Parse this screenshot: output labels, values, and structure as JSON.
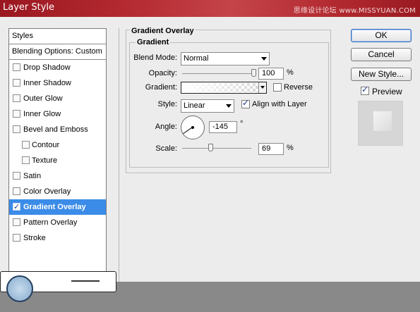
{
  "window": {
    "title": "Layer Style",
    "watermark": "思缘设计论坛 www.MISSYUAN.COM"
  },
  "styles_list": {
    "header": "Styles",
    "blending": "Blending Options: Custom",
    "items": [
      {
        "label": "Drop Shadow",
        "checked": false
      },
      {
        "label": "Inner Shadow",
        "checked": false
      },
      {
        "label": "Outer Glow",
        "checked": false
      },
      {
        "label": "Inner Glow",
        "checked": false
      },
      {
        "label": "Bevel and Emboss",
        "checked": false
      },
      {
        "label": "Contour",
        "checked": false
      },
      {
        "label": "Texture",
        "checked": false
      },
      {
        "label": "Satin",
        "checked": false
      },
      {
        "label": "Color Overlay",
        "checked": false
      },
      {
        "label": "Gradient Overlay",
        "checked": true
      },
      {
        "label": "Pattern Overlay",
        "checked": false
      },
      {
        "label": "Stroke",
        "checked": false
      }
    ]
  },
  "panel": {
    "title": "Gradient Overlay",
    "group": "Gradient",
    "blend_mode_label": "Blend Mode:",
    "blend_mode_value": "Normal",
    "opacity_label": "Opacity:",
    "opacity_value": "100",
    "opacity_unit": "%",
    "opacity_level": 1.0,
    "gradient_label": "Gradient:",
    "reverse_label": "Reverse",
    "reverse_checked": false,
    "style_label": "Style:",
    "style_value": "Linear",
    "align_label": "Align with Layer",
    "align_checked": true,
    "angle_label": "Angle:",
    "angle_value": "-145",
    "angle_unit": "°",
    "scale_label": "Scale:",
    "scale_value": "69",
    "scale_unit": "%",
    "scale_level": 0.69
  },
  "buttons": {
    "ok": "OK",
    "cancel": "Cancel",
    "new_style": "New Style...",
    "preview_label": "Preview",
    "preview_checked": true
  }
}
